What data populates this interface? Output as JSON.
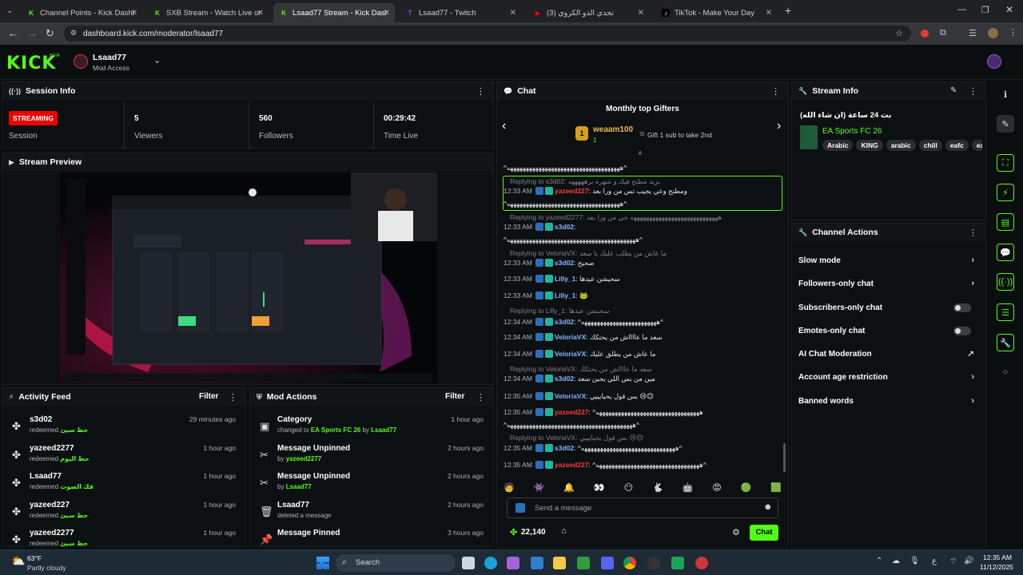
{
  "browser": {
    "tabs": [
      {
        "label": "Channel Points - Kick Dashboa",
        "fav": "K",
        "color": "#53fc18"
      },
      {
        "label": "SXB Stream - Watch Live on",
        "fav": "K",
        "color": "#53fc18"
      },
      {
        "label": "Lsaad77 Stream - Kick Dash",
        "fav": "K",
        "color": "#53fc18"
      },
      {
        "label": "Lsaad77 - Twitch",
        "fav": "T",
        "color": "#9146ff"
      },
      {
        "label": "(3) تحدي الدو الكروي",
        "fav": "▶",
        "color": "#ff0000"
      },
      {
        "label": "TikTok - Make Your Day",
        "fav": "♪",
        "color": "#ffffff"
      }
    ],
    "url": "dashboard.kick.com/moderator/lsaad77"
  },
  "header": {
    "logo": "KICK",
    "beta": "BETA",
    "channel_name": "Lsaad77",
    "access": "Mod Access"
  },
  "session": {
    "title": "Session Info",
    "status": "STREAMING",
    "status_label": "Session",
    "viewers": "5",
    "viewers_label": "Viewers",
    "followers": "560",
    "followers_label": "Followers",
    "time_live": "00:29:42",
    "time_label": "Time Live"
  },
  "preview": {
    "title": "Stream Preview"
  },
  "activity": {
    "title": "Activity Feed",
    "filter": "Filter",
    "items": [
      {
        "name": "s3d02",
        "action": "redeemed",
        "reward": "حظ سيئ",
        "time": "29 minutes ago"
      },
      {
        "name": "yazeed2277",
        "action": "redeemed",
        "reward": "حظ اليوم",
        "time": "1 hour ago"
      },
      {
        "name": "Lsaad77",
        "action": "redeemed",
        "reward": "فك الصوت",
        "time": "1 hour ago"
      },
      {
        "name": "yazeed227",
        "action": "redeemed",
        "reward": "حظ سيئ",
        "time": "1 hour ago"
      },
      {
        "name": "yazeed2277",
        "action": "redeemed",
        "reward": "حظ سيئ",
        "time": "1 hour ago"
      }
    ]
  },
  "modactions": {
    "title": "Mod Actions",
    "filter": "Filter",
    "items": [
      {
        "title": "Category",
        "line": "changed to",
        "hl": "EA Sports FC 26",
        "mid": "by",
        "user": "Lsaad77",
        "time": "1 hour ago"
      },
      {
        "title": "Message Unpinned",
        "line": "by",
        "hl": "",
        "mid": "",
        "user": "yazeed2277",
        "time": "2 hours ago"
      },
      {
        "title": "Message Unpinned",
        "line": "by",
        "hl": "",
        "mid": "",
        "user": "Lsaad77",
        "time": "2 hours ago"
      },
      {
        "title": "Lsaad77",
        "line": "deleted a message",
        "hl": "",
        "mid": "",
        "user": "",
        "time": "2 hours ago"
      },
      {
        "title": "Message Pinned",
        "line": "",
        "hl": "",
        "mid": "",
        "user": "",
        "time": "3 hours ago"
      }
    ]
  },
  "chat": {
    "title": "Chat",
    "gifters_title": "Monthly top Gifters",
    "top_gifter": "weaam100",
    "gift_count": "1",
    "gift_text": "Gift 1 sub to take 2nd",
    "messages": [
      {
        "time": "",
        "reply": "",
        "user": "",
        "ucolor": "#fff",
        "text": "^ههههههههههههههههههههههههههههههههههههه^"
      },
      {
        "time": "",
        "reply": "Replying to s3d02: يزيد مطنح فيك و شهره برهههههه",
        "user": "",
        "ucolor": "#fff",
        "text": ""
      },
      {
        "time": "12:33 AM",
        "reply": "",
        "user": "yazeed227",
        "ucolor": "#ff3b3b",
        "text": "ومطنح وعي يجيب تس من ورا بعد"
      },
      {
        "time": "",
        "reply": "",
        "user": "",
        "ucolor": "#fff",
        "text": "^ههههههههههههههههههههههههههههههههههههه^"
      },
      {
        "time": "",
        "reply": "Replying to yazeed2277: ههههههههههههههههههههههههههههه جي من ورا بعد",
        "user": "",
        "ucolor": "#fff",
        "text": ""
      },
      {
        "time": "12:33 AM",
        "reply": "",
        "user": "s3d02",
        "ucolor": "#8ab4ff",
        "text": ""
      },
      {
        "time": "",
        "reply": "",
        "user": "",
        "ucolor": "#fff",
        "text": "^هههههههههههههههههههههههههههههههههههههههههه^"
      },
      {
        "time": "",
        "reply": "Replying to VeloriaVX: ما عاش من يطلب عليك يا سعد",
        "user": "",
        "ucolor": "#fff",
        "text": ""
      },
      {
        "time": "12:33 AM",
        "reply": "",
        "user": "s3d02",
        "ucolor": "#8ab4ff",
        "text": "صحيح"
      },
      {
        "time": "12:33 AM",
        "reply": "",
        "user": "Lilly_1",
        "ucolor": "#8ab4ff",
        "text": "سحيشن عيدها"
      },
      {
        "time": "12:33 AM",
        "reply": "",
        "user": "Lilly_1",
        "ucolor": "#8ab4ff",
        "text": "🐸"
      },
      {
        "time": "",
        "reply": "Replying to Lilly_1: سحيشن عيدها",
        "user": "",
        "ucolor": "#fff",
        "text": ""
      },
      {
        "time": "12:34 AM",
        "reply": "",
        "user": "s3d02",
        "ucolor": "#8ab4ff",
        "text": "^ههههههههههههههههههههههههه^"
      },
      {
        "time": "12:34 AM",
        "reply": "",
        "user": "VeloriaVX",
        "ucolor": "#8ab4ff",
        "text": "سعد ما عااااش من يحتكك"
      },
      {
        "time": "12:34 AM",
        "reply": "",
        "user": "VeloriaVX",
        "ucolor": "#8ab4ff",
        "text": "ما عاش من يطلق عليك"
      },
      {
        "time": "",
        "reply": "Replying to VeloriaVX: سعد ما عااااش من يحتكك",
        "user": "",
        "ucolor": "#fff",
        "text": ""
      },
      {
        "time": "12:34 AM",
        "reply": "",
        "user": "s3d02",
        "ucolor": "#8ab4ff",
        "text": "مين من بس اللي يجين سعد"
      },
      {
        "time": "12:35 AM",
        "reply": "",
        "user": "VeloriaVX",
        "ucolor": "#8ab4ff",
        "text": "بس قول يحيايييي 😢😊"
      },
      {
        "time": "12:35 AM",
        "reply": "",
        "user": "yazeed227",
        "ucolor": "#ff3b3b",
        "text": "^هههههههههههههههههههههههههههههههههه"
      },
      {
        "time": "",
        "reply": "",
        "user": "",
        "ucolor": "#fff",
        "text": "^ههههههههههههههههههههههههههههههههههههههههه^"
      },
      {
        "time": "",
        "reply": "Replying to VeloriaVX: بس قول يحيايييي 😢😊",
        "user": "",
        "ucolor": "#fff",
        "text": ""
      },
      {
        "time": "12:35 AM",
        "reply": "",
        "user": "s3d02",
        "ucolor": "#8ab4ff",
        "text": "^ههههههههههههههههههههههههههههههه^"
      },
      {
        "time": "12:35 AM",
        "reply": "",
        "user": "yazeed227",
        "ucolor": "#ff3b3b",
        "text": "^هههههههههههههههههههههههههههههههههه^"
      }
    ],
    "input_placeholder": "Send a message",
    "points": "22,140",
    "send_label": "Chat"
  },
  "streaminfo": {
    "title": "Stream Info",
    "stream_title": "بث 24 ساعة (ان شاء الله)",
    "category": "EA Sports FC 26",
    "tags": [
      "Arabic",
      "KING",
      "arabic",
      "chill",
      "eafc",
      "ea"
    ]
  },
  "channelactions": {
    "title": "Channel Actions",
    "items": [
      {
        "label": "Slow mode",
        "kind": "arrow"
      },
      {
        "label": "Followers-only chat",
        "kind": "arrow"
      },
      {
        "label": "Subscribers-only chat",
        "kind": "toggle"
      },
      {
        "label": "Emotes-only chat",
        "kind": "toggle"
      },
      {
        "label": "AI Chat Moderation",
        "kind": "ext"
      },
      {
        "label": "Account age restriction",
        "kind": "arrow"
      },
      {
        "label": "Banned words",
        "kind": "arrow"
      }
    ]
  },
  "taskbar": {
    "temp": "63°F",
    "weather": "Partly cloudy",
    "search": "Search",
    "time": "12:35 AM",
    "date": "11/12/2025"
  },
  "colors": {
    "accent": "#53fc18",
    "streaming": "#eb0400",
    "bg": "#0b0e0f"
  }
}
